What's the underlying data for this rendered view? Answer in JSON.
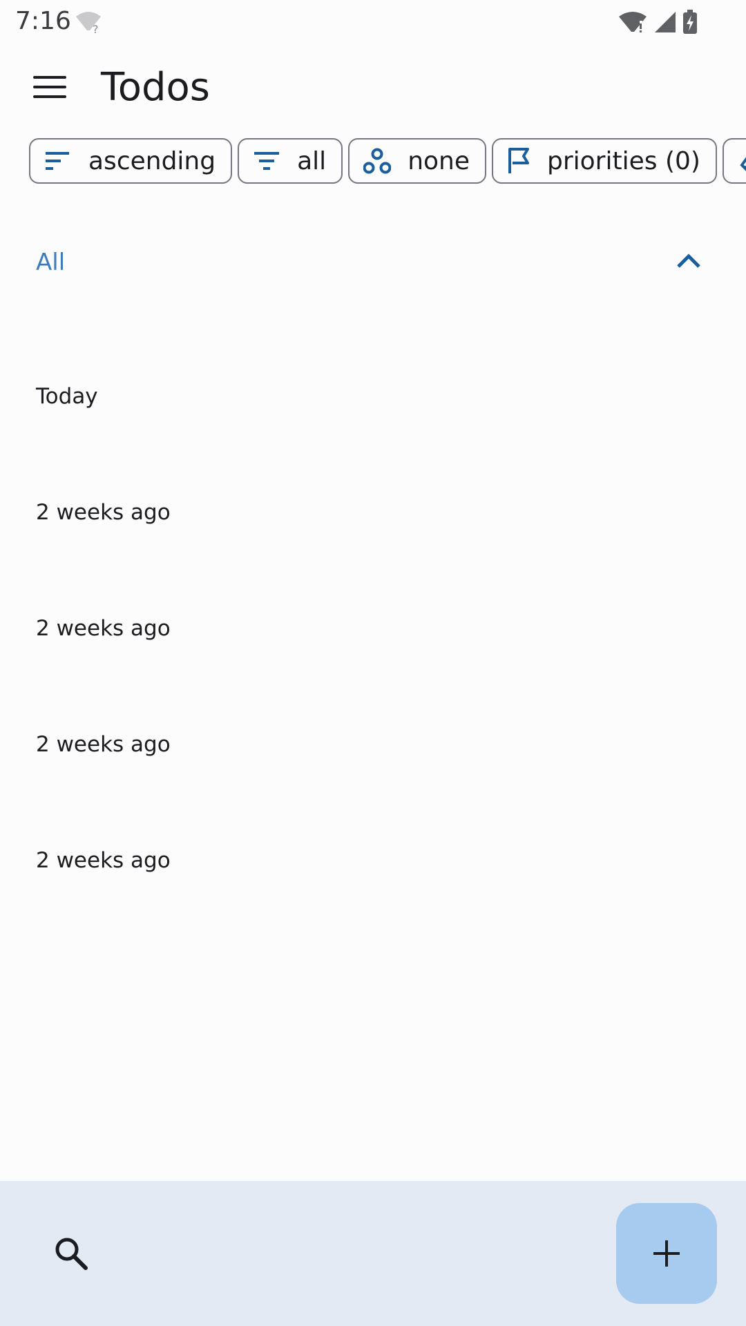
{
  "status_bar": {
    "time": "7:16"
  },
  "app_bar": {
    "title": "Todos"
  },
  "chips": [
    {
      "label": "ascending",
      "icon": "sort-icon"
    },
    {
      "label": "all",
      "icon": "filter-icon"
    },
    {
      "label": "none",
      "icon": "group-icon"
    },
    {
      "label": "priorities (0)",
      "icon": "flag-icon"
    }
  ],
  "section": {
    "label": "All",
    "expanded": true
  },
  "items": [
    {
      "label": "Today"
    },
    {
      "label": "2 weeks ago"
    },
    {
      "label": "2 weeks ago"
    },
    {
      "label": "2 weeks ago"
    },
    {
      "label": "2 weeks ago"
    }
  ],
  "colors": {
    "accent": "#1a5e9e",
    "section_label": "#3e7bbd",
    "bottom_bar": "#e4eaf3",
    "fab": "#a6cbee"
  }
}
